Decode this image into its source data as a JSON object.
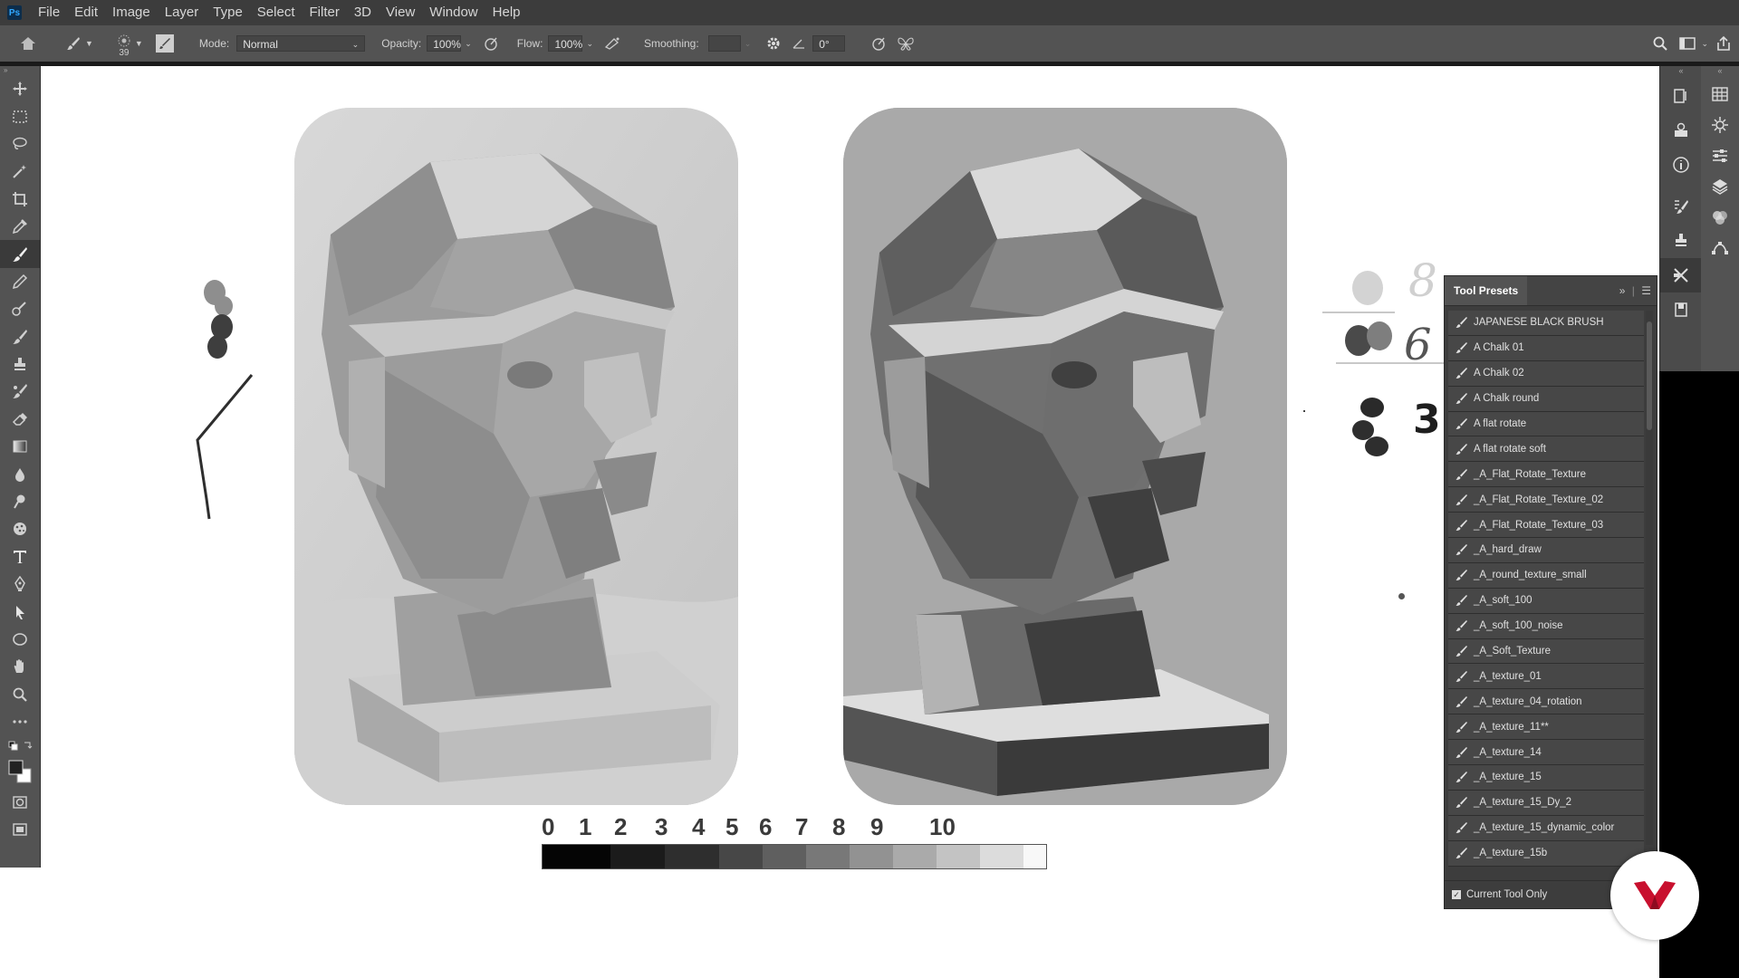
{
  "app": {
    "logo_text": "Ps"
  },
  "menu": [
    "File",
    "Edit",
    "Image",
    "Layer",
    "Type",
    "Select",
    "Filter",
    "3D",
    "View",
    "Window",
    "Help"
  ],
  "options_bar": {
    "brush_size": "39",
    "mode_label": "Mode:",
    "mode_value": "Normal",
    "opacity_label": "Opacity:",
    "opacity_value": "100%",
    "flow_label": "Flow:",
    "flow_value": "100%",
    "smoothing_label": "Smoothing:",
    "smoothing_value": "",
    "angle_value": "0°"
  },
  "value_scale": {
    "numbers": [
      "0",
      "1",
      "2",
      "3",
      "4",
      "5",
      "6",
      "7",
      "8",
      "9",
      "10"
    ],
    "swatches": [
      "#050505",
      "#1b1b1b",
      "#2e2e2e",
      "#474747",
      "#5f5f5f",
      "#787878",
      "#929292",
      "#aaaaaa",
      "#c3c3c3",
      "#dcdcdc",
      "#f8f8f8"
    ]
  },
  "value_notes": [
    "8",
    "6",
    "3"
  ],
  "tool_presets": {
    "title": "Tool Presets",
    "items": [
      "JAPANESE BLACK BRUSH",
      "A  Chalk 01",
      "A  Chalk 02",
      "A  Chalk  round",
      "A  flat  rotate",
      "A  flat  rotate  soft",
      "_A_Flat_Rotate_Texture",
      "_A_Flat_Rotate_Texture_02",
      "_A_Flat_Rotate_Texture_03",
      "_A_hard_draw",
      "_A_round_texture_small",
      "_A_soft_100",
      "_A_soft_100_noise",
      "_A_Soft_Texture",
      "_A_texture_01",
      "_A_texture_04_rotation",
      "_A_texture_11**",
      "_A_texture_14",
      "_A_texture_15",
      "_A_texture_15_Dy_2",
      "_A_texture_15_dynamic_color",
      "_A_texture_15b"
    ],
    "footer": "Current Tool Only"
  },
  "colors": {
    "accent_red": "#c8102e",
    "ui_dark": "#3c3c3c",
    "ui_mid": "#535353"
  }
}
